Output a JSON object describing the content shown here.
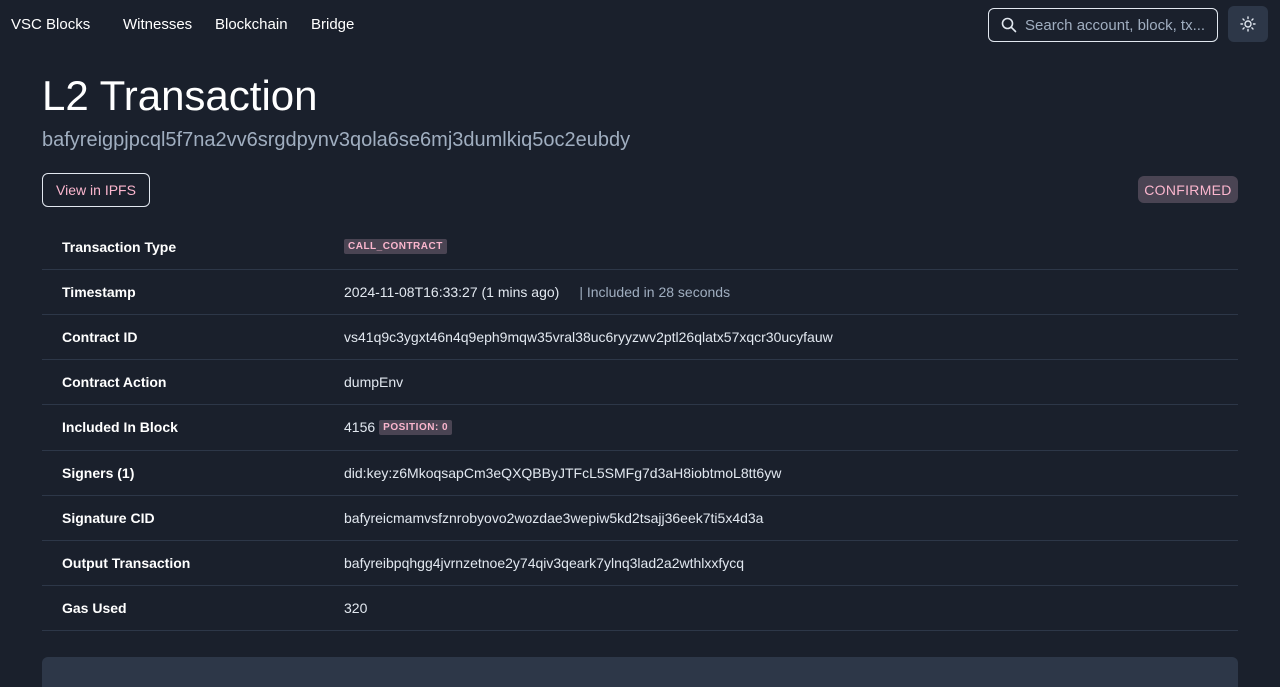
{
  "nav": {
    "brand": "VSC Blocks",
    "links": [
      "Witnesses",
      "Blockchain",
      "Bridge"
    ],
    "search_placeholder": "Search account, block, tx..."
  },
  "page": {
    "title": "L2 Transaction",
    "hash": "bafyreigpjpcql5f7na2vv6srgdpynv3qola6se6mj3dumlkiq5oc2eubdy",
    "ipfs_button": "View in IPFS",
    "status": "CONFIRMED"
  },
  "details": {
    "transaction_type": {
      "label": "Transaction Type",
      "value": "CALL_CONTRACT"
    },
    "timestamp": {
      "label": "Timestamp",
      "value": "2024-11-08T16:33:27 (1 mins ago)",
      "included": "| Included in 28 seconds"
    },
    "contract_id": {
      "label": "Contract ID",
      "value": "vs41q9c3ygxt46n4q9eph9mqw35vral38uc6ryyzwv2ptl26qlatx57xqcr30ucyfauw"
    },
    "contract_action": {
      "label": "Contract Action",
      "value": "dumpEnv"
    },
    "included_in_block": {
      "label": "Included In Block",
      "value": "4156",
      "position": "POSITION: 0"
    },
    "signers": {
      "label": "Signers (1)",
      "value": "did:key:z6MkoqsapCm3eQXQBByJTFcL5SMFg7d3aH8iobtmoL8tt6yw"
    },
    "signature_cid": {
      "label": "Signature CID",
      "value": "bafyreicmamvsfznrobyovo2wozdae3wepiw5kd2tsajj36eek7ti5x4d3a"
    },
    "output_transaction": {
      "label": "Output Transaction",
      "value": "bafyreibpqhgg4jvrnzetnoe2y74qiv3qeark7ylnq3lad2a2wthlxxfycq"
    },
    "gas_used": {
      "label": "Gas Used",
      "value": "320"
    }
  },
  "icons": {
    "search": "search-icon",
    "theme": "sun-icon"
  },
  "colors": {
    "background": "#1a202c",
    "accent_pink": "#fbb6ce",
    "badge_bg": "#4a4453"
  }
}
